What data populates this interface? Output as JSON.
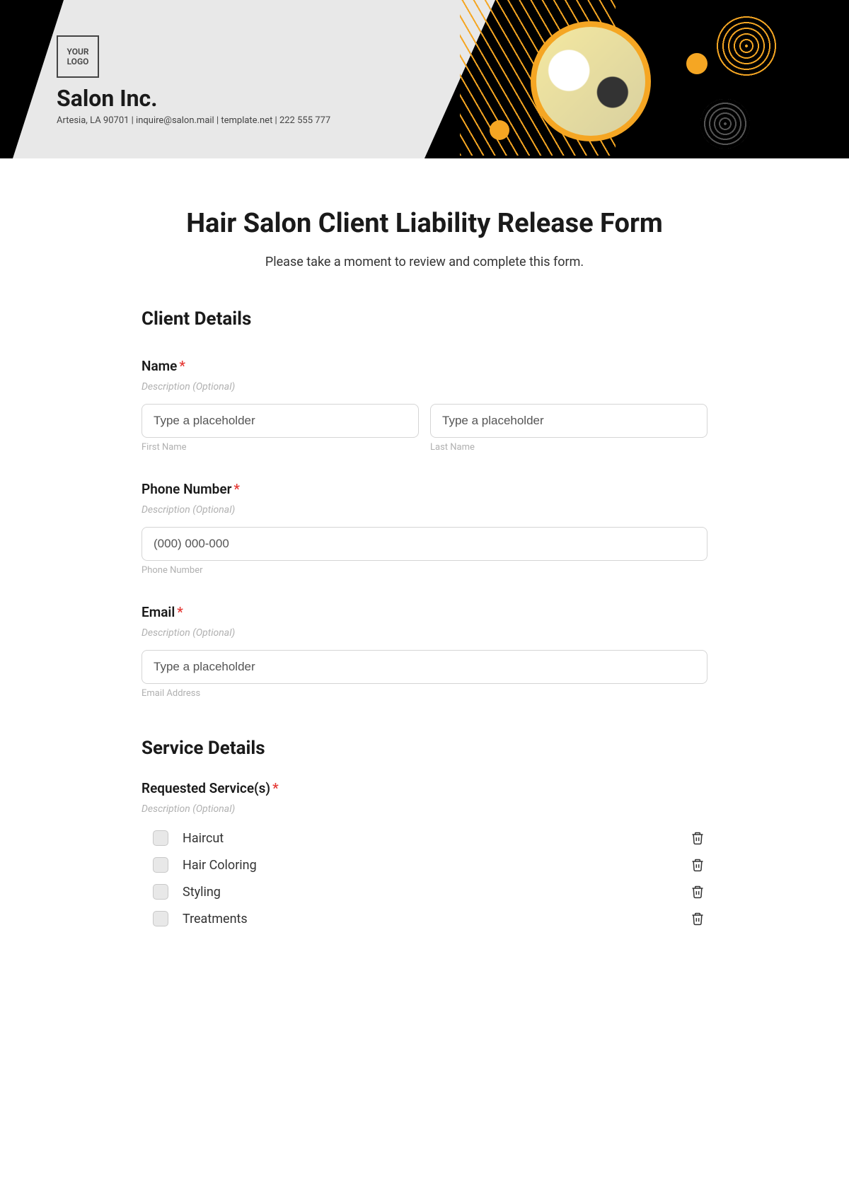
{
  "header": {
    "logo_text": "YOUR LOGO",
    "company_name": "Salon Inc.",
    "meta": "Artesia, LA 90701 | inquire@salon.mail | template.net | 222 555 777"
  },
  "form": {
    "title": "Hair Salon Client Liability Release Form",
    "subtitle": "Please take a moment to review and complete this form."
  },
  "sections": {
    "client_heading": "Client Details",
    "service_heading": "Service Details"
  },
  "fields": {
    "name": {
      "label": "Name",
      "desc": "Description (Optional)",
      "first_placeholder": "Type a placeholder",
      "first_sub": "First Name",
      "last_placeholder": "Type a placeholder",
      "last_sub": "Last Name"
    },
    "phone": {
      "label": "Phone Number",
      "desc": "Description (Optional)",
      "placeholder": "(000) 000-000",
      "sub": "Phone Number"
    },
    "email": {
      "label": "Email",
      "desc": "Description (Optional)",
      "placeholder": "Type a placeholder",
      "sub": "Email Address"
    },
    "services": {
      "label": "Requested Service(s)",
      "desc": "Description (Optional)",
      "options": [
        "Haircut",
        "Hair Coloring",
        "Styling",
        "Treatments"
      ]
    }
  },
  "required_marker": "*"
}
